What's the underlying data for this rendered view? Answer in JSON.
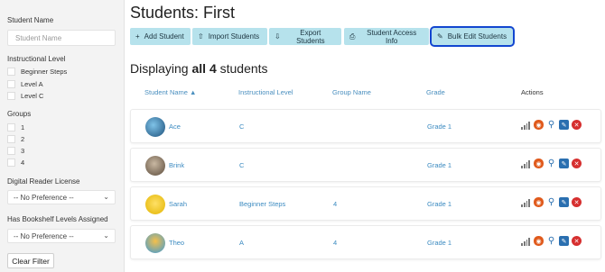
{
  "sidebar": {
    "student_name_label": "Student Name",
    "student_name_placeholder": "Student Name",
    "instructional_level_label": "Instructional Level",
    "levels": [
      "Beginner Steps",
      "Level A",
      "Level C"
    ],
    "groups_label": "Groups",
    "groups": [
      "1",
      "2",
      "3",
      "4"
    ],
    "drl_label": "Digital Reader License",
    "drl_value": "-- No Preference --",
    "bookshelf_label": "Has Bookshelf Levels Assigned",
    "bookshelf_value": "-- No Preference --",
    "clear_filter": "Clear Filter"
  },
  "page": {
    "title": "Students: First"
  },
  "toolbar": {
    "add_student": "Add Student",
    "import_students": "Import Students",
    "export_students": "Export Students",
    "student_access_info": "Student Access Info",
    "bulk_edit_students": "Bulk Edit Students"
  },
  "summary": {
    "prefix": "Displaying ",
    "count_text": "all 4",
    "suffix": " students"
  },
  "table": {
    "headers": {
      "student_name": "Student Name ▲",
      "instructional_level": "Instructional Level",
      "group_name": "Group Name",
      "grade": "Grade",
      "actions": "Actions"
    },
    "rows": [
      {
        "name": "Ace",
        "level": "C",
        "group": "",
        "grade": "Grade 1"
      },
      {
        "name": "Brink",
        "level": "C",
        "group": "",
        "grade": "Grade 1"
      },
      {
        "name": "Sarah",
        "level": "Beginner Steps",
        "group": "4",
        "grade": "Grade 1"
      },
      {
        "name": "Theo",
        "level": "A",
        "group": "4",
        "grade": "Grade 1"
      }
    ]
  },
  "icons": {
    "add": "plus-icon",
    "import": "upload-icon",
    "export": "download-icon",
    "access": "printer-icon",
    "bulk": "pencil-icon",
    "actions": [
      "reading-level-bars-icon",
      "mask-icon",
      "key-icon",
      "edit-icon",
      "delete-icon"
    ]
  },
  "colors": {
    "toolbar_button": "#b6e2ec",
    "highlight_outline": "#1246d0",
    "link": "#3c8bc1",
    "delete": "#d62f2f",
    "mask": "#e05a1c"
  }
}
